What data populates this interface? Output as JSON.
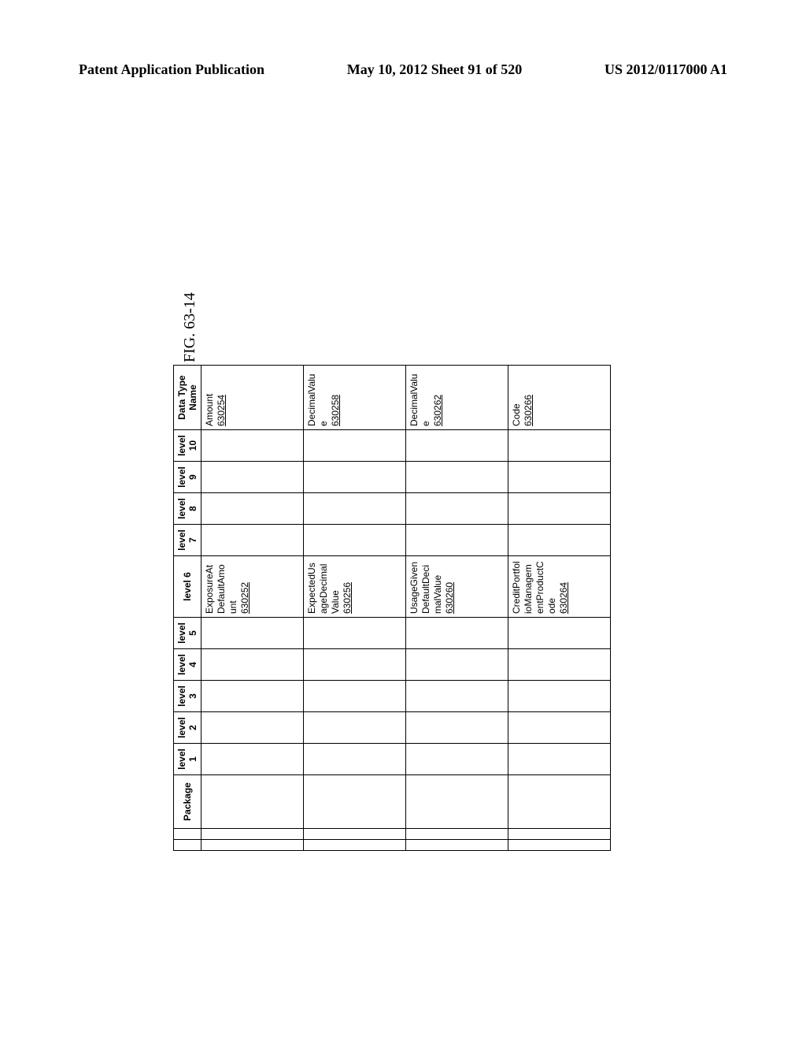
{
  "header": {
    "left": "Patent Application Publication",
    "center": "May 10, 2012  Sheet 91 of 520",
    "right": "US 2012/0117000 A1"
  },
  "figure_label": "FIG. 63-14",
  "columns": {
    "package": "Package",
    "levels": [
      "level 1",
      "level 2",
      "level 3",
      "level 4",
      "level 5",
      "level 6",
      "level 7",
      "level 8",
      "level 9",
      "level 10"
    ],
    "data_type_name": "Data Type Name"
  },
  "rows": [
    {
      "level6_text": "ExposureAtDefaultAmount",
      "level6_ref": "630252",
      "dtn_text": "Amount",
      "dtn_ref": "630254"
    },
    {
      "level6_text": "ExpectedUsageDecimalValue",
      "level6_ref": "630256",
      "dtn_text": "DecimalValue",
      "dtn_ref": "630258"
    },
    {
      "level6_text": "UsageGivenDefaultDecimalValue",
      "level6_ref": "630260",
      "dtn_text": "DecimalValue",
      "dtn_ref": "630262"
    },
    {
      "level6_text": "CreditPortfolioManagementProductCode",
      "level6_ref": "630264",
      "dtn_text": "Code",
      "dtn_ref": "630266"
    }
  ]
}
